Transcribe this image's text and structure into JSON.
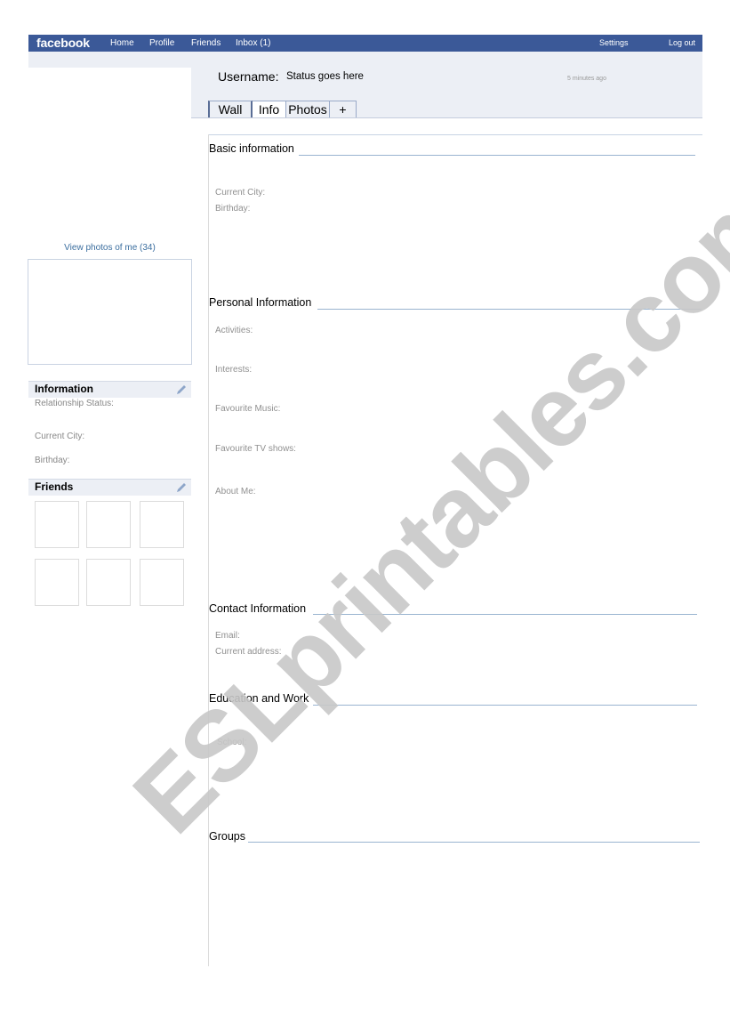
{
  "topbar": {
    "logo": "facebook",
    "nav": [
      "Home",
      "Profile",
      "Friends",
      "Inbox (1)"
    ],
    "settings": "Settings",
    "logout": "Log out",
    "color": "#3b5998"
  },
  "profile_header": {
    "username_label": "Username:",
    "status": "Status goes here",
    "timestamp": "5 minutes ago",
    "tabs": [
      "Wall",
      "Info",
      "Photos",
      "+"
    ],
    "active_tab": "Info"
  },
  "sidebar": {
    "view_photos": "View photos of me (34)",
    "information": {
      "title": "Information",
      "fields": [
        "Relationship Status:",
        "Current City:",
        "Birthday:"
      ]
    },
    "friends": {
      "title": "Friends",
      "count_boxes": 6
    }
  },
  "main": {
    "sections": [
      {
        "title": "Basic information",
        "fields": [
          "Current City:",
          "Birthday:"
        ]
      },
      {
        "title": "Personal Information",
        "fields": [
          "Activities:",
          "Interests:",
          "Favourite Music:",
          "Favourite TV shows:",
          "About Me:"
        ]
      },
      {
        "title": "Contact Information",
        "fields": [
          "Email:",
          "Current address:"
        ]
      },
      {
        "title": "Education and Work",
        "fields": [
          "School:"
        ]
      },
      {
        "title": "Groups",
        "fields": []
      }
    ]
  },
  "watermark": "ESLprintables.com"
}
